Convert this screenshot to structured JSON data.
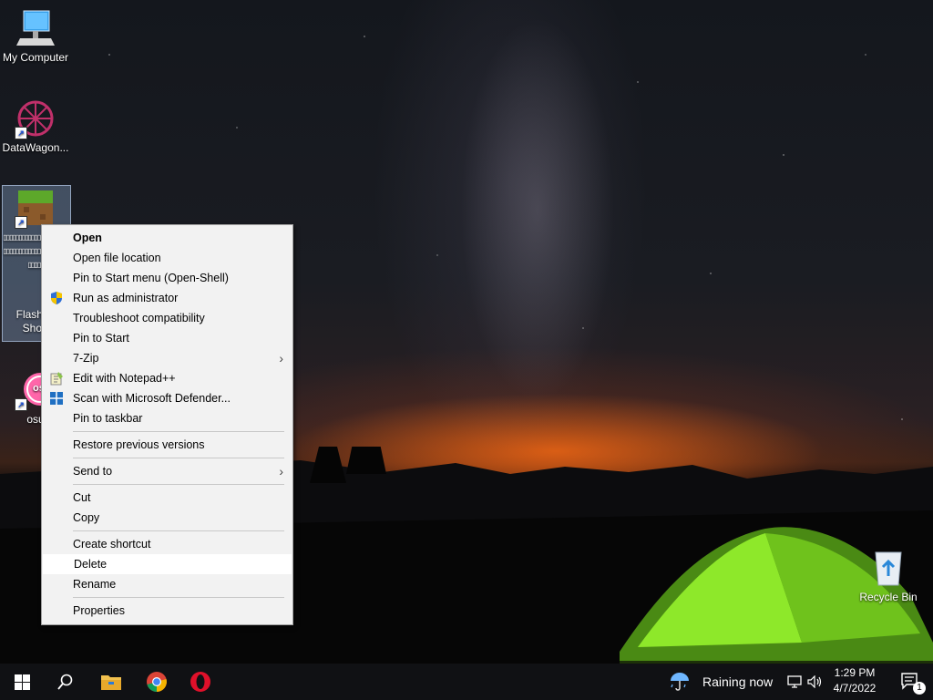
{
  "desktop": {
    "icons": [
      {
        "label": "My Computer"
      },
      {
        "label": "DataWagon..."
      },
      {
        "label": "▯▯▯▯▯▯▯▯▯▯▯▯▯▯▯▯▯▯▯▯▯▯▯▯▯▯▯▯▯▯▯▯▯▯▯▯▯▯▯▯▯▯▯▯▯▯▯",
        "sublabel": "Flashpo",
        "sublabel2": "Short"
      },
      {
        "label": "osu"
      }
    ],
    "recycle_bin": "Recycle Bin",
    "osu_badge": "osu"
  },
  "context_menu": {
    "items": [
      {
        "label": "Open"
      },
      {
        "label": "Open file location"
      },
      {
        "label": "Pin to Start menu (Open-Shell)"
      },
      {
        "label": "Run as administrator"
      },
      {
        "label": "Troubleshoot compatibility"
      },
      {
        "label": "Pin to Start"
      },
      {
        "label": "7-Zip"
      },
      {
        "label": "Edit with Notepad++"
      },
      {
        "label": "Scan with Microsoft Defender..."
      },
      {
        "label": "Pin to taskbar"
      },
      {
        "label": "Restore previous versions"
      },
      {
        "label": "Send to"
      },
      {
        "label": "Cut"
      },
      {
        "label": "Copy"
      },
      {
        "label": "Create shortcut"
      },
      {
        "label": "Delete"
      },
      {
        "label": "Rename"
      },
      {
        "label": "Properties"
      }
    ]
  },
  "taskbar": {
    "weather": "Raining now",
    "time": "1:29 PM",
    "date": "4/7/2022",
    "notification_count": "1"
  },
  "colors": {
    "taskbar": "#101114",
    "menu_bg": "#f2f2f2",
    "tent": "#7ed321"
  }
}
